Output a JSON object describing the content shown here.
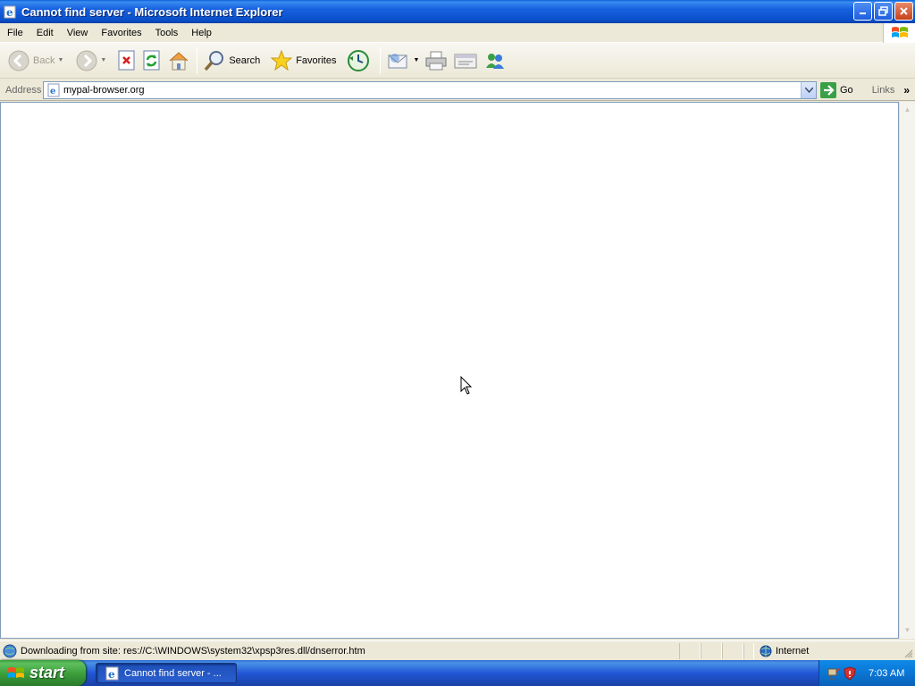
{
  "window": {
    "title": "Cannot find server - Microsoft Internet Explorer"
  },
  "menu": {
    "items": [
      "File",
      "Edit",
      "View",
      "Favorites",
      "Tools",
      "Help"
    ]
  },
  "toolbar": {
    "back_label": "Back",
    "search_label": "Search",
    "favorites_label": "Favorites"
  },
  "address": {
    "label": "Address",
    "url": "mypal-browser.org",
    "go_label": "Go",
    "links_label": "Links"
  },
  "status": {
    "message": "Downloading from site: res://C:\\WINDOWS\\system32\\xpsp3res.dll/dnserror.htm",
    "zone": "Internet"
  },
  "taskbar": {
    "start_label": "start",
    "task_label": "Cannot find server - ...",
    "clock": "7:03 AM"
  }
}
